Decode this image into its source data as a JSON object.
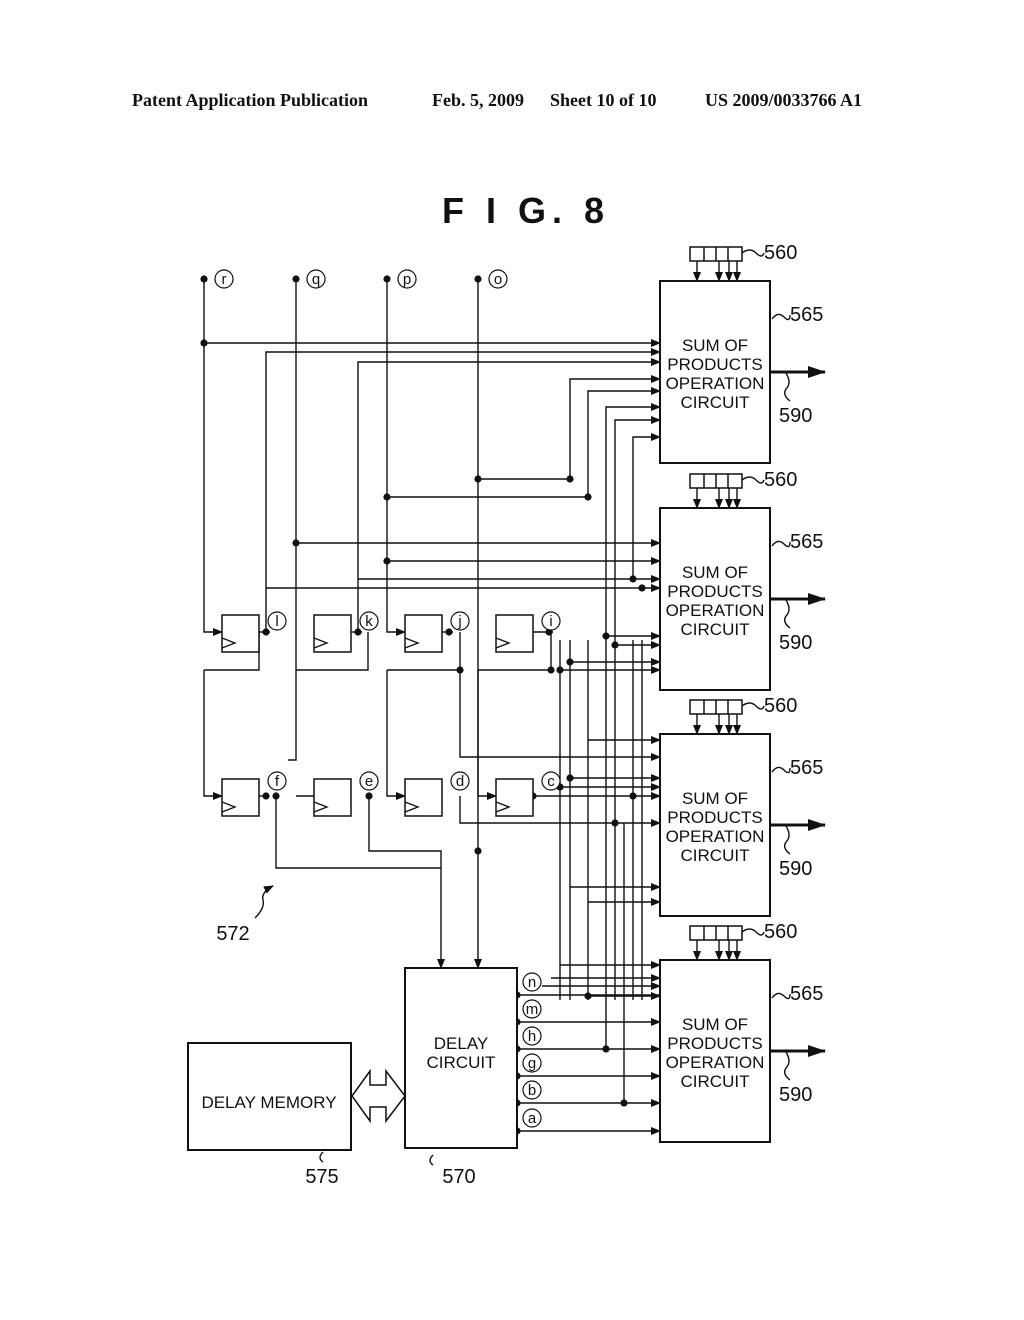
{
  "header": {
    "publication": "Patent Application Publication",
    "date": "Feb. 5, 2009",
    "sheet": "Sheet 10 of 10",
    "patent_number": "US 2009/0033766 A1"
  },
  "figure": {
    "title": "F I G.  8",
    "inputs": [
      "r",
      "q",
      "p",
      "o"
    ],
    "upper_taps": [
      "l",
      "k",
      "j",
      "i"
    ],
    "lower_taps": [
      "f",
      "e",
      "d",
      "c"
    ],
    "delay_outputs": [
      "n",
      "m",
      "h",
      "g",
      "b",
      "a"
    ],
    "sop_blocks": [
      {
        "label_lines": [
          "SUM OF",
          "PRODUCTS",
          "OPERATION",
          "CIRCUIT"
        ],
        "ref": "565",
        "coef_ref": "560",
        "out_ref": "590"
      },
      {
        "label_lines": [
          "SUM OF",
          "PRODUCTS",
          "OPERATION",
          "CIRCUIT"
        ],
        "ref": "565",
        "coef_ref": "560",
        "out_ref": "590"
      },
      {
        "label_lines": [
          "SUM OF",
          "PRODUCTS",
          "OPERATION",
          "CIRCUIT"
        ],
        "ref": "565",
        "coef_ref": "560",
        "out_ref": "590"
      },
      {
        "label_lines": [
          "SUM OF",
          "PRODUCTS",
          "OPERATION",
          "CIRCUIT"
        ],
        "ref": "565",
        "coef_ref": "560",
        "out_ref": "590"
      }
    ],
    "delay_circuit": {
      "label_lines": [
        "DELAY",
        "CIRCUIT"
      ],
      "ref": "570"
    },
    "delay_memory": {
      "label": "DELAY MEMORY",
      "ref": "575"
    },
    "register_array_ref": "572"
  }
}
